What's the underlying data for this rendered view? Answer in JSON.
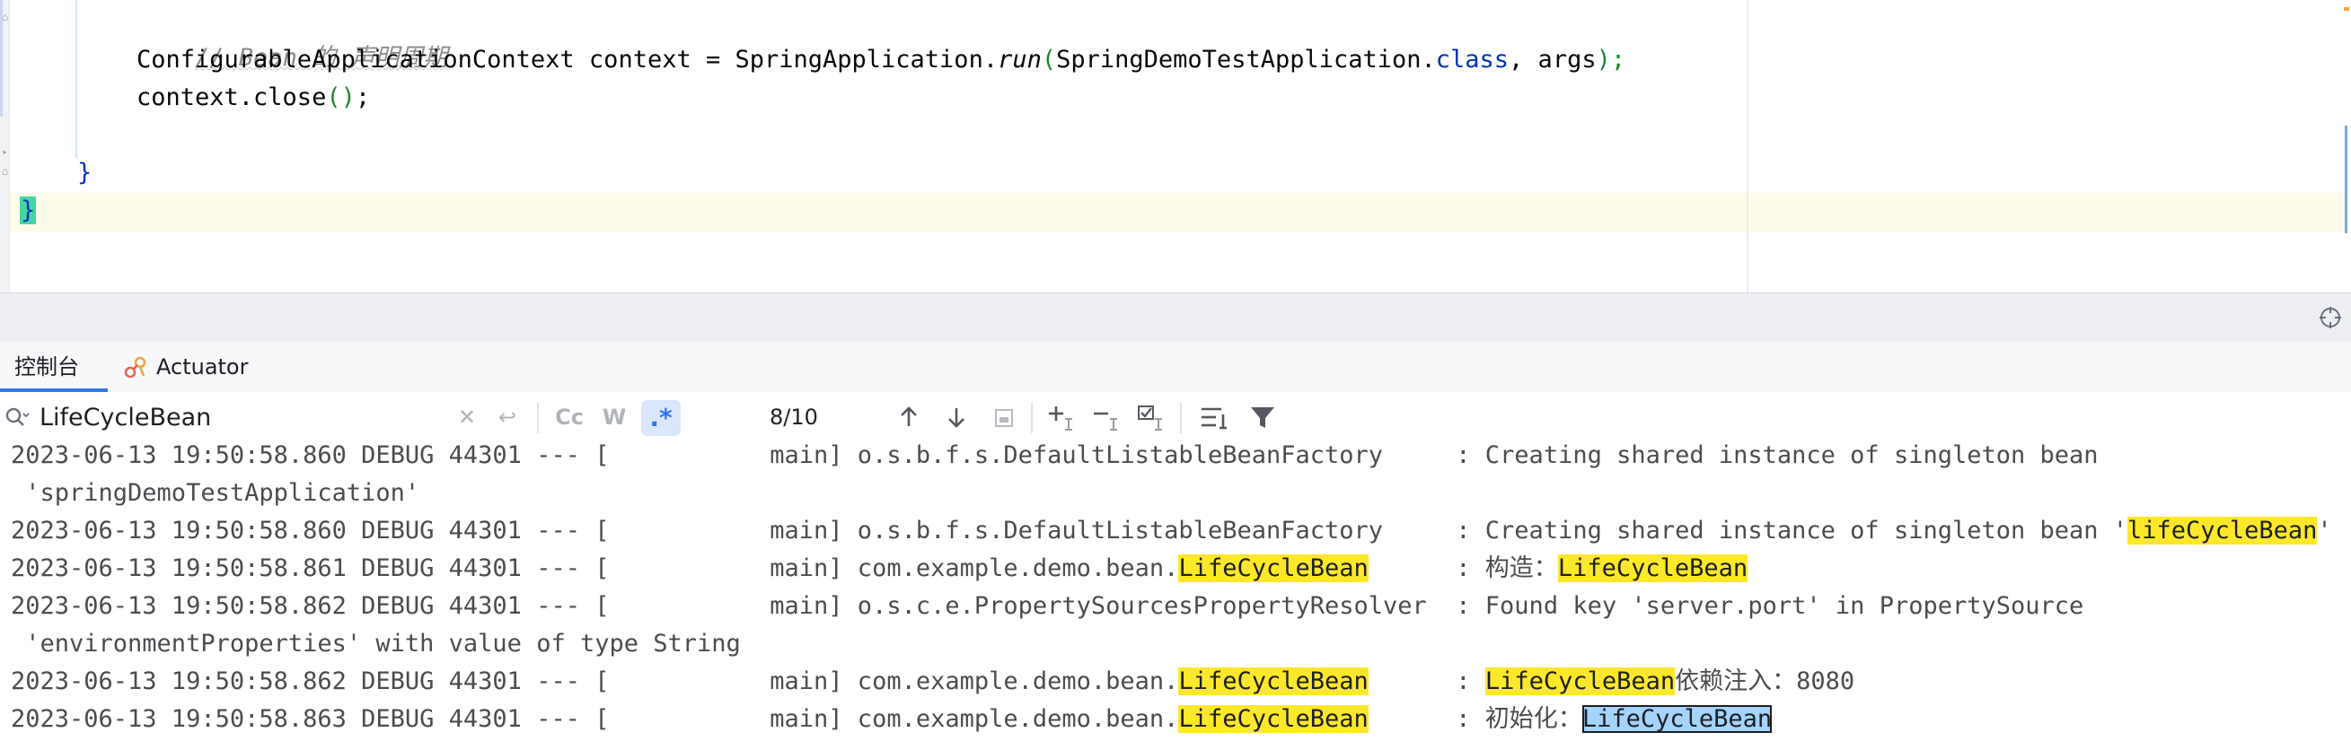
{
  "editor": {
    "comment": "// Bean 的 声明周期",
    "line2": {
      "type": "ConfigurableApplicationContext",
      "var": " context = SpringApplication.",
      "method": "run",
      "open": "(",
      "arg_class": "SpringDemoTestApplication.",
      "kw_class": "class",
      "rest": ", args",
      "close": ");"
    },
    "line3": {
      "prefix": "context.close",
      "parens": "()",
      "suffix": ";"
    },
    "method_close_brace": "}",
    "class_close_brace": "}"
  },
  "tool_window": {
    "tabs": [
      {
        "label": "控制台",
        "active": true
      },
      {
        "label": "Actuator",
        "active": false
      }
    ]
  },
  "search": {
    "query": "LifeCycleBean",
    "match_case_label": "Cc",
    "words_label": "W",
    "regex_label": ".*",
    "match_count": "8/10"
  },
  "console": {
    "lines": [
      {
        "parts": [
          {
            "t": "2023-06-13 19:50:58.860 DEBUG 44301 --- [           main] o.s.b.f.s.DefaultListableBeanFactory     : Creating shared instance of singleton bean",
            "h": ""
          }
        ]
      },
      {
        "parts": [
          {
            "t": " 'springDemoTestApplication'",
            "h": ""
          }
        ]
      },
      {
        "parts": [
          {
            "t": "2023-06-13 19:50:58.860 DEBUG 44301 --- [           main] o.s.b.f.s.DefaultListableBeanFactory     : Creating shared instance of singleton bean '",
            "h": ""
          },
          {
            "t": "lifeCycleBean",
            "h": "hl"
          },
          {
            "t": "'",
            "h": ""
          }
        ]
      },
      {
        "parts": [
          {
            "t": "2023-06-13 19:50:58.861 DEBUG 44301 --- [           main] com.example.demo.bean.",
            "h": ""
          },
          {
            "t": "LifeCycleBean",
            "h": "hl"
          },
          {
            "t": "      : 构造：",
            "h": ""
          },
          {
            "t": "LifeCycleBean",
            "h": "hl"
          }
        ]
      },
      {
        "parts": [
          {
            "t": "2023-06-13 19:50:58.862 DEBUG 44301 --- [           main] o.s.c.e.PropertySourcesPropertyResolver  : Found key 'server.port' in PropertySource",
            "h": ""
          }
        ]
      },
      {
        "parts": [
          {
            "t": " 'environmentProperties' with value of type String",
            "h": ""
          }
        ]
      },
      {
        "parts": [
          {
            "t": "2023-06-13 19:50:58.862 DEBUG 44301 --- [           main] com.example.demo.bean.",
            "h": ""
          },
          {
            "t": "LifeCycleBean",
            "h": "hl"
          },
          {
            "t": "      : ",
            "h": ""
          },
          {
            "t": "LifeCycleBean",
            "h": "hl"
          },
          {
            "t": "依赖注入：8080",
            "h": ""
          }
        ]
      },
      {
        "parts": [
          {
            "t": "2023-06-13 19:50:58.863 DEBUG 44301 --- [           main] com.example.demo.bean.",
            "h": ""
          },
          {
            "t": "LifeCycleBean",
            "h": "hl"
          },
          {
            "t": "      : 初始化：",
            "h": ""
          },
          {
            "t": "LifeCycleBean",
            "h": "hl-current"
          }
        ]
      }
    ]
  },
  "colors": {
    "search_highlight": "#fce82a",
    "current_match": "#a5d3fb",
    "keyword": "#0033b3",
    "accent": "#3574f0"
  }
}
